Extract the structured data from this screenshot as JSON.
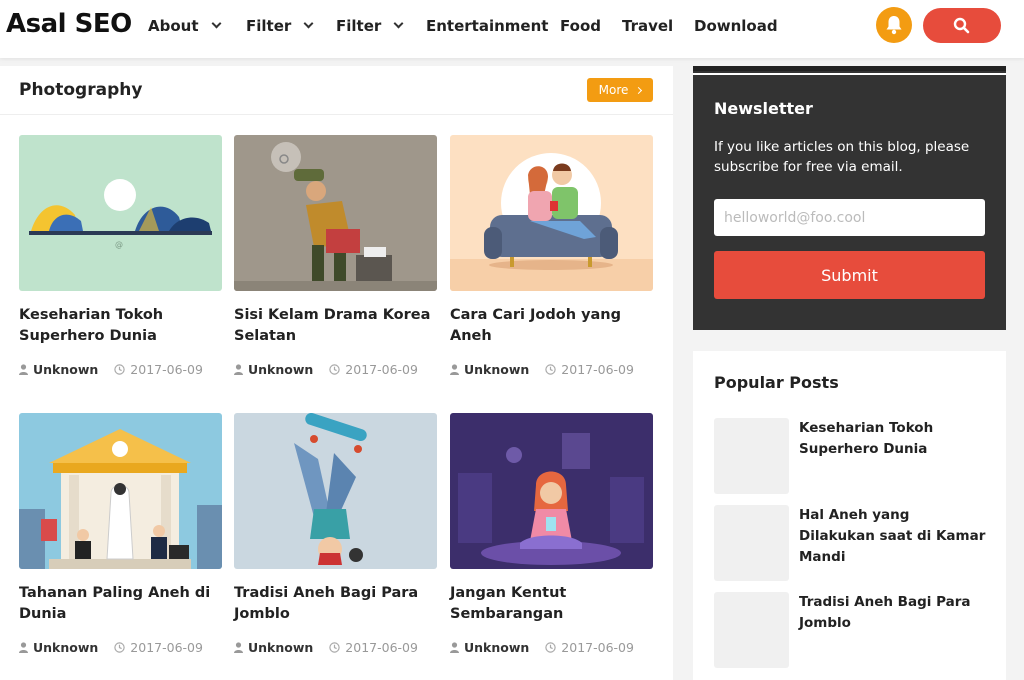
{
  "header": {
    "logo": "Asal SEO",
    "nav": [
      {
        "label": "About",
        "dropdown": true
      },
      {
        "label": "Filter",
        "dropdown": true
      },
      {
        "label": "Filter",
        "dropdown": true
      },
      {
        "label": "Entertainment",
        "dropdown": false
      },
      {
        "label": "Food",
        "dropdown": false
      },
      {
        "label": "Travel",
        "dropdown": false
      },
      {
        "label": "Download",
        "dropdown": false
      }
    ],
    "icons": {
      "notify": "bell-icon",
      "search": "search-icon"
    }
  },
  "main": {
    "section_title": "Photography",
    "more_label": "More",
    "posts": [
      {
        "title": "Keseharian Tokoh Superhero Dunia",
        "author": "Unknown",
        "date": "2017-06-09"
      },
      {
        "title": "Sisi Kelam Drama Korea Selatan",
        "author": "Unknown",
        "date": "2017-06-09"
      },
      {
        "title": "Cara Cari Jodoh yang Aneh",
        "author": "Unknown",
        "date": "2017-06-09"
      },
      {
        "title": "Tahanan Paling Aneh di Dunia",
        "author": "Unknown",
        "date": "2017-06-09"
      },
      {
        "title": "Tradisi Aneh Bagi Para Jomblo",
        "author": "Unknown",
        "date": "2017-06-09"
      },
      {
        "title": "Jangan Kentut Sembarangan",
        "author": "Unknown",
        "date": "2017-06-09"
      }
    ]
  },
  "newsletter": {
    "title": "Newsletter",
    "description": "If you like articles on this blog, please subscribe for free via email.",
    "email_placeholder": "helloworld@foo.cool",
    "email_value": "",
    "submit_label": "Submit"
  },
  "popular": {
    "title": "Popular Posts",
    "items": [
      {
        "title": "Keseharian Tokoh Superhero Dunia"
      },
      {
        "title": "Hal Aneh yang Dilakukan saat di Kamar Mandi"
      },
      {
        "title": "Tradisi Aneh Bagi Para Jomblo"
      }
    ]
  },
  "colors": {
    "accent_orange": "#f39c12",
    "accent_red": "#e74c3c",
    "newsletter_bg": "#333333"
  }
}
